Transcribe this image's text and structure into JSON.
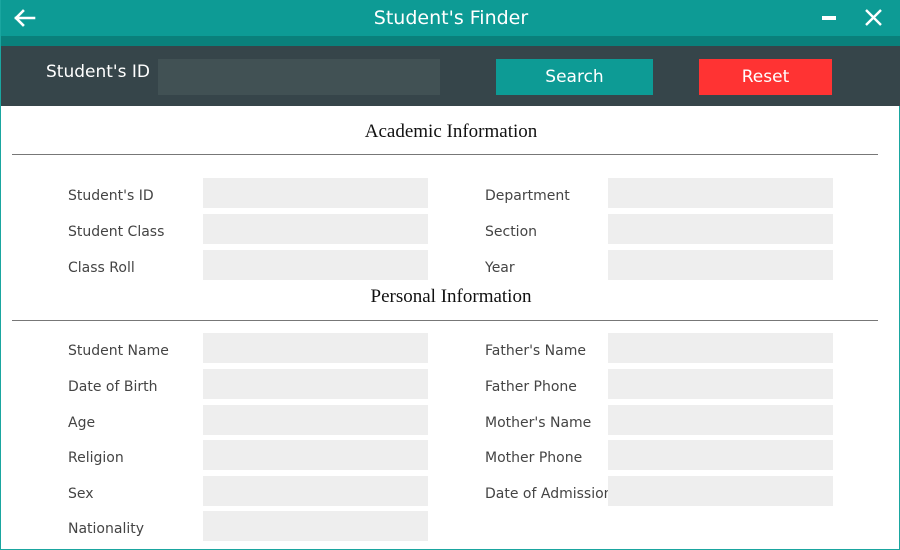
{
  "window": {
    "title": "Student's Finder",
    "icons": {
      "back": "arrow-left-icon",
      "minimize": "minus-icon",
      "close": "x-close-icon"
    },
    "colors": {
      "titlebar": "#0d9b95",
      "search_bar": "#36454a",
      "search_button": "#0d9b95",
      "reset_button": "#ff3333"
    }
  },
  "search": {
    "label": "Student's ID",
    "value": "",
    "placeholder": "",
    "search_label": "Search",
    "reset_label": "Reset"
  },
  "academic": {
    "title": "Academic Information",
    "left": [
      {
        "label": "Student's ID",
        "value": ""
      },
      {
        "label": "Student Class",
        "value": ""
      },
      {
        "label": "Class Roll",
        "value": ""
      }
    ],
    "right": [
      {
        "label": "Department",
        "value": ""
      },
      {
        "label": "Section",
        "value": ""
      },
      {
        "label": "Year",
        "value": ""
      }
    ]
  },
  "personal": {
    "title": "Personal Information",
    "left": [
      {
        "label": "Student Name",
        "value": ""
      },
      {
        "label": "Date of Birth",
        "value": ""
      },
      {
        "label": "Age",
        "value": ""
      },
      {
        "label": "Religion",
        "value": ""
      },
      {
        "label": "Sex",
        "value": ""
      },
      {
        "label": "Nationality",
        "value": ""
      }
    ],
    "right": [
      {
        "label": "Father's Name",
        "value": ""
      },
      {
        "label": "Father Phone",
        "value": ""
      },
      {
        "label": "Mother's Name",
        "value": ""
      },
      {
        "label": "Mother Phone",
        "value": ""
      },
      {
        "label": "Date of Admission",
        "value": ""
      }
    ]
  }
}
